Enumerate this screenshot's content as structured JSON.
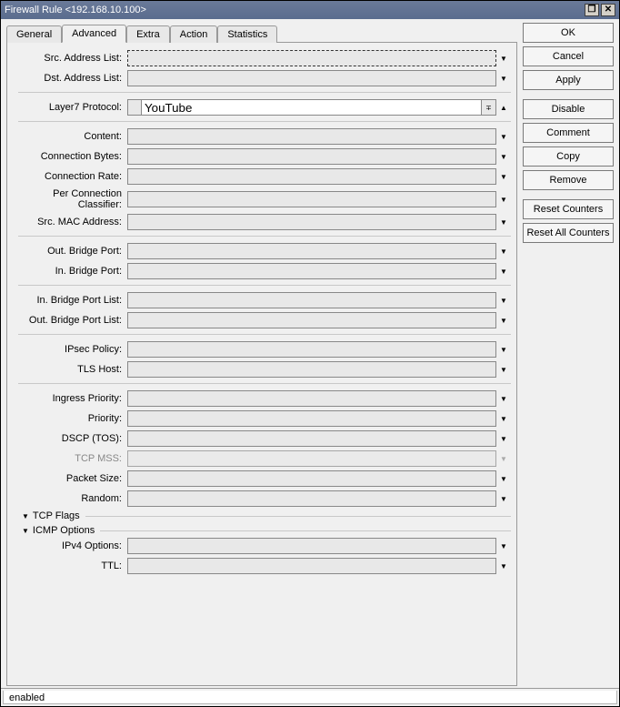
{
  "window": {
    "title": "Firewall Rule <192.168.10.100>"
  },
  "tabs": {
    "general": "General",
    "advanced": "Advanced",
    "extra": "Extra",
    "action": "Action",
    "statistics": "Statistics"
  },
  "buttons": {
    "ok": "OK",
    "cancel": "Cancel",
    "apply": "Apply",
    "disable": "Disable",
    "comment": "Comment",
    "copy": "Copy",
    "remove": "Remove",
    "reset_counters": "Reset Counters",
    "reset_all_counters": "Reset All Counters"
  },
  "fields": {
    "src_address_list": {
      "label": "Src. Address List:",
      "value": ""
    },
    "dst_address_list": {
      "label": "Dst. Address List:",
      "value": ""
    },
    "layer7_protocol": {
      "label": "Layer7 Protocol:",
      "value": "YouTube"
    },
    "content": {
      "label": "Content:",
      "value": ""
    },
    "connection_bytes": {
      "label": "Connection Bytes:",
      "value": ""
    },
    "connection_rate": {
      "label": "Connection Rate:",
      "value": ""
    },
    "per_connection_classifier": {
      "label": "Per Connection Classifier:",
      "value": ""
    },
    "src_mac_address": {
      "label": "Src. MAC Address:",
      "value": ""
    },
    "out_bridge_port": {
      "label": "Out. Bridge Port:",
      "value": ""
    },
    "in_bridge_port": {
      "label": "In. Bridge Port:",
      "value": ""
    },
    "in_bridge_port_list": {
      "label": "In. Bridge Port List:",
      "value": ""
    },
    "out_bridge_port_list": {
      "label": "Out. Bridge Port List:",
      "value": ""
    },
    "ipsec_policy": {
      "label": "IPsec Policy:",
      "value": ""
    },
    "tls_host": {
      "label": "TLS Host:",
      "value": ""
    },
    "ingress_priority": {
      "label": "Ingress Priority:",
      "value": ""
    },
    "priority": {
      "label": "Priority:",
      "value": ""
    },
    "dscp_tos": {
      "label": "DSCP (TOS):",
      "value": ""
    },
    "tcp_mss": {
      "label": "TCP MSS:",
      "value": ""
    },
    "packet_size": {
      "label": "Packet Size:",
      "value": ""
    },
    "random": {
      "label": "Random:",
      "value": ""
    },
    "ipv4_options": {
      "label": "IPv4 Options:",
      "value": ""
    },
    "ttl": {
      "label": "TTL:",
      "value": ""
    }
  },
  "disclosures": {
    "tcp_flags": "TCP Flags",
    "icmp_options": "ICMP Options"
  },
  "status": {
    "enabled": "enabled"
  }
}
